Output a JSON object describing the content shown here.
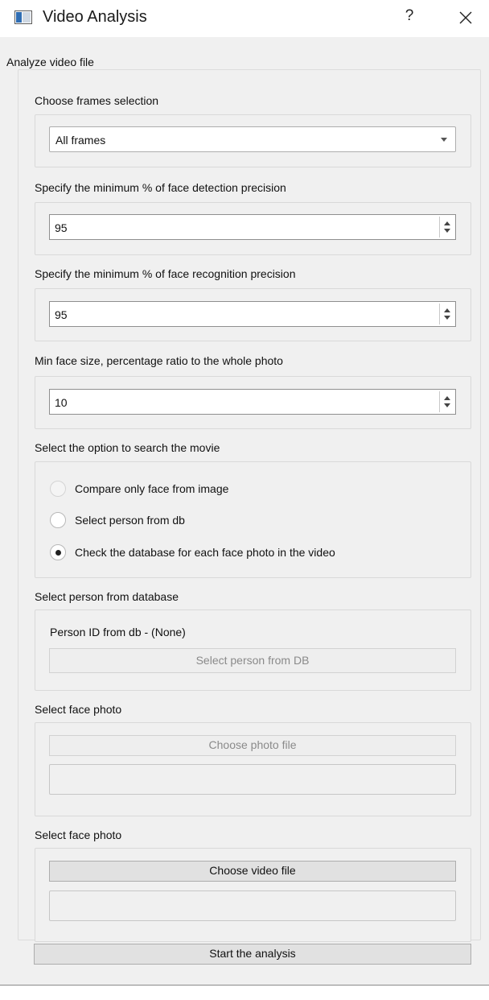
{
  "window": {
    "title": "Video Analysis",
    "help_label": "?",
    "close_icon": "close-icon",
    "app_icon": "window-icon"
  },
  "main": {
    "group_title": "Analyze video file",
    "frames": {
      "label": "Choose frames selection",
      "selected": "All frames"
    },
    "detection": {
      "label": "Specify the minimum % of face detection precision",
      "value": "95"
    },
    "recognition": {
      "label": "Specify the minimum % of face recognition precision",
      "value": "95"
    },
    "face_size": {
      "label": "Min face size, percentage ratio to the whole photo",
      "value": "10"
    },
    "search_option": {
      "label": "Select the option to search the movie",
      "options": [
        {
          "label": "Compare only face from image",
          "checked": false,
          "enabled": false
        },
        {
          "label": "Select person from db",
          "checked": false,
          "enabled": true
        },
        {
          "label": "Check the database for each face photo in the video",
          "checked": true,
          "enabled": true
        }
      ]
    },
    "person": {
      "label": "Select person from database",
      "id_text": "Person ID from db - (None)",
      "button": "Select person from DB"
    },
    "photo": {
      "label": "Select face photo",
      "button": "Choose photo file",
      "path": ""
    },
    "video": {
      "label": "Select face photo",
      "button": "Choose video file",
      "path": ""
    },
    "start_button": "Start the analysis"
  }
}
